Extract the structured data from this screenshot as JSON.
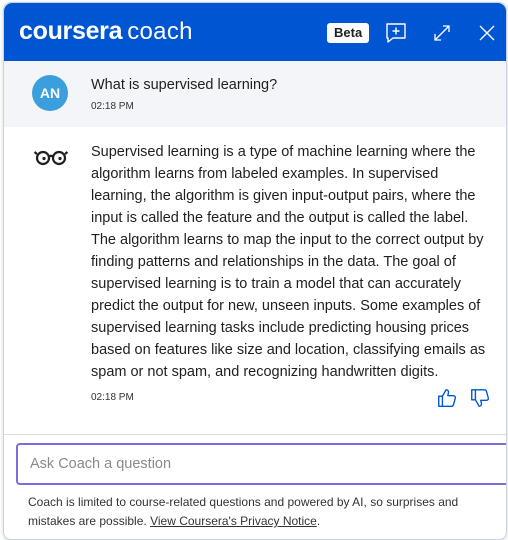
{
  "header": {
    "brand": "coursera",
    "product": "coach",
    "badge": "Beta",
    "icons": [
      "new-chat-icon",
      "expand-icon",
      "close-icon"
    ]
  },
  "conversation": {
    "user_message": {
      "avatar_initials": "AN",
      "text": "What is supervised learning?",
      "time": "02:18 PM"
    },
    "bot_message": {
      "icon": "glasses-icon",
      "text": "Supervised learning is a type of machine learning where the algorithm learns from labeled examples. In supervised learning, the algorithm is given input-output pairs, where the input is called the feature and the output is called the label. The algorithm learns to map the input to the correct output by finding patterns and relationships in the data. The goal of supervised learning is to train a model that can accurately predict the output for new, unseen inputs. Some examples of supervised learning tasks include predicting housing prices based on features like size and location, classifying emails as spam or not spam, and recognizing handwritten digits.",
      "time": "02:18 PM",
      "feedback_icons": [
        "thumbs-up-icon",
        "thumbs-down-icon"
      ]
    }
  },
  "composer": {
    "placeholder": "Ask Coach a question",
    "value": "",
    "send_icon": "send-icon"
  },
  "disclaimer": {
    "text": "Coach is limited to course-related questions and powered by AI, so surprises and mistakes are possible. ",
    "link": "View Coursera's Privacy Notice",
    "suffix": "."
  },
  "colors": {
    "header_bg": "#0056d2",
    "avatar_bg": "#3a9fdc",
    "input_border": "#7d6cdb",
    "user_msg_bg": "#f3f5f8"
  }
}
